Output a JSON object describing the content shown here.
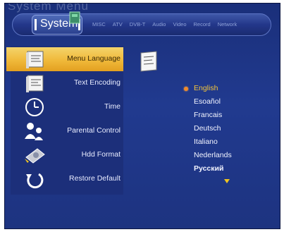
{
  "header": {
    "ghost_text": "System Menu",
    "title": "System",
    "tabs": [
      "MISC",
      "ATV",
      "DVB-T",
      "Audio",
      "Video",
      "Record",
      "Network"
    ]
  },
  "menu": {
    "items": [
      {
        "label": "Menu Language",
        "icon": "document-language-icon",
        "active": true
      },
      {
        "label": "Text Encoding",
        "icon": "document-encoding-icon",
        "active": false
      },
      {
        "label": "Time",
        "icon": "clock-icon",
        "active": false
      },
      {
        "label": "Parental Control",
        "icon": "parent-child-icon",
        "active": false
      },
      {
        "label": "Hdd Format",
        "icon": "hard-disk-icon",
        "active": false
      },
      {
        "label": "Restore Default",
        "icon": "restore-arrow-icon",
        "active": false
      }
    ]
  },
  "options": {
    "selected": "English",
    "items": [
      "English",
      "Esoañol",
      "Francais",
      "Deutsch",
      "Italiano",
      "Nederlands",
      "Pусский"
    ],
    "more_indicator": "down-arrow-icon"
  },
  "colors": {
    "background": "#1f3588",
    "highlight": "#f0b93a",
    "selected_text": "#f3c43a",
    "bullet": "#f08a2a"
  }
}
